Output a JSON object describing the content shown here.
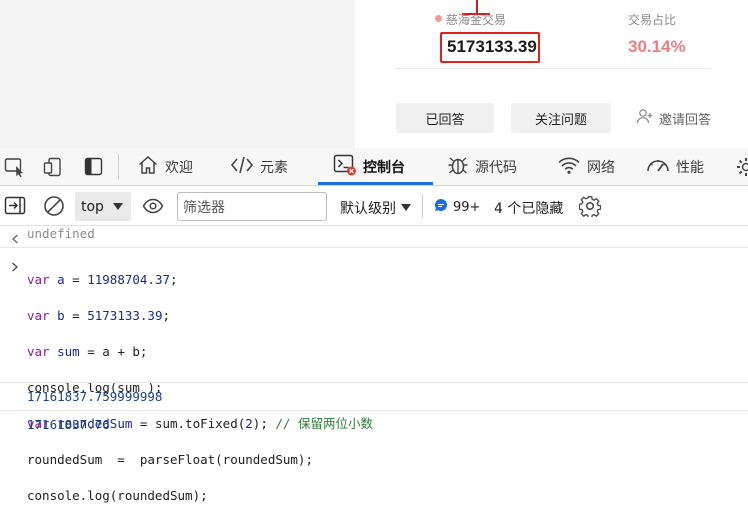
{
  "page": {
    "stat_label": "慈海金交易",
    "stat_value": "5173133.39",
    "ratio_label": "交易占比",
    "ratio_value": "30.14%",
    "btn_answered": "已回答",
    "btn_follow": "关注问题",
    "btn_invite": "邀请回答"
  },
  "devtools": {
    "tabs": [
      {
        "label": "欢迎",
        "icon": "home-icon"
      },
      {
        "label": "元素",
        "icon": "code-tags-icon"
      },
      {
        "label": "控制台",
        "icon": "console-icon",
        "active": true
      },
      {
        "label": "源代码",
        "icon": "bug-icon"
      },
      {
        "label": "网络",
        "icon": "wifi-icon"
      },
      {
        "label": "性能",
        "icon": "gauge-icon"
      }
    ],
    "toolbar": {
      "context": "top",
      "filter_placeholder": "筛选器",
      "level": "默认级别",
      "message_count": "99+",
      "hidden": "4 个已隐藏"
    },
    "colors": {
      "accent": "#1a6fd6",
      "error_badge": "#e23b2e",
      "highlight": "#e2231a"
    }
  },
  "console": {
    "prior_result": "undefined",
    "code": {
      "line1": {
        "kw": "var",
        "name": "a",
        "op": " = ",
        "val": "11988704.37",
        "end": ";"
      },
      "line2": {
        "kw": "var",
        "name": "b",
        "op": " = ",
        "val": "5173133.39",
        "end": ";"
      },
      "line3": {
        "kw": "var",
        "name": "sum",
        "rest": " = a + b;"
      },
      "line4": "console.log(sum );",
      "line5": {
        "kw": "var",
        "name": "roundedSum",
        "rest": " = sum.toFixed(",
        "arg": "2",
        "close": "); ",
        "comment": "// 保留两位小数"
      },
      "line6": "roundedSum  =  parseFloat(roundedSum);",
      "line7": "console.log(roundedSum);"
    },
    "output1": "17161837.759999998",
    "output2": "17161837.76"
  }
}
